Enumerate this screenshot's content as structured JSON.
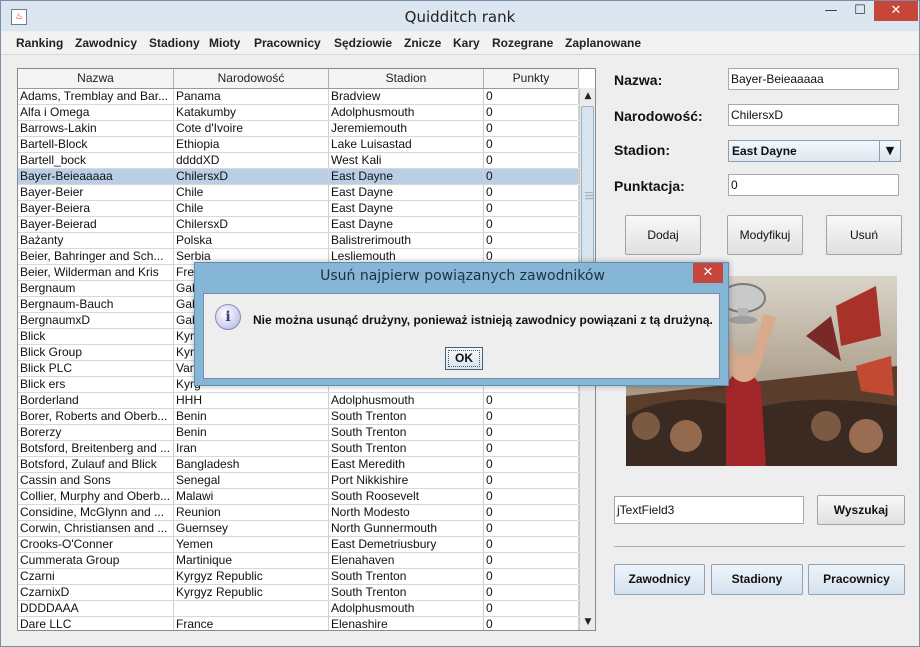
{
  "window": {
    "title": "Quidditch rank",
    "min": "—",
    "max": "☐",
    "close": "✕",
    "app_icon": "java-icon"
  },
  "menu": [
    "Ranking",
    "Zawodnicy",
    "Stadiony",
    "Mioty",
    "Pracownicy",
    "Sędziowie",
    "Znicze",
    "Kary",
    "Rozegrane",
    "Zaplanowane"
  ],
  "table": {
    "headers": [
      "Nazwa",
      "Narodowość",
      "Stadion",
      "Punkty"
    ],
    "selected_row": 5,
    "rows": [
      [
        "Adams, Tremblay and Bar...",
        "Panama",
        "Bradview",
        "0"
      ],
      [
        "Alfa i Omega",
        "Katakumby",
        "Adolphusmouth",
        "0"
      ],
      [
        "Barrows-Lakin",
        "Cote d'Ivoire",
        "Jeremiemouth",
        "0"
      ],
      [
        "Bartell-Block",
        "Ethiopia",
        "Lake Luisastad",
        "0"
      ],
      [
        "Bartell_bock",
        "ddddXD",
        "West Kali",
        "0"
      ],
      [
        "Bayer-Beieaaaaa",
        "ChilersxD",
        "East Dayne",
        "0"
      ],
      [
        "Bayer-Beier",
        "Chile",
        "East Dayne",
        "0"
      ],
      [
        "Bayer-Beiera",
        "Chile",
        "East Dayne",
        "0"
      ],
      [
        "Bayer-Beierad",
        "ChilersxD",
        "East Dayne",
        "0"
      ],
      [
        "Bażanty",
        "Polska",
        "Balistrerimouth",
        "0"
      ],
      [
        "Beier, Bahringer and Sch...",
        "Serbia",
        "Lesliemouth",
        "0"
      ],
      [
        "Beier, Wilderman and Kris",
        "Fren",
        "",
        ""
      ],
      [
        "Bergnaum",
        "Gab",
        "",
        ""
      ],
      [
        "Bergnaum-Bauch",
        "Gab",
        "",
        ""
      ],
      [
        "BergnaumxD",
        "Gab",
        "",
        ""
      ],
      [
        "Blick",
        "Kyrg",
        "",
        ""
      ],
      [
        "Blick Group",
        "Kyrg",
        "",
        ""
      ],
      [
        "Blick PLC",
        "Van",
        "",
        ""
      ],
      [
        "Blick ers",
        "Kyrg",
        "",
        ""
      ],
      [
        "Borderland",
        "HHH",
        "Adolphusmouth",
        "0"
      ],
      [
        "Borer, Roberts and Oberb...",
        "Benin",
        "South Trenton",
        "0"
      ],
      [
        "Borerzy",
        "Benin",
        "South Trenton",
        "0"
      ],
      [
        "Botsford, Breitenberg and ...",
        "Iran",
        "South Trenton",
        "0"
      ],
      [
        "Botsford, Zulauf and Blick",
        "Bangladesh",
        "East Meredith",
        "0"
      ],
      [
        "Cassin and Sons",
        "Senegal",
        "Port Nikkishire",
        "0"
      ],
      [
        "Collier, Murphy and Oberb...",
        "Malawi",
        "South Roosevelt",
        "0"
      ],
      [
        "Considine, McGlynn and ...",
        "Reunion",
        "North Modesto",
        "0"
      ],
      [
        "Corwin, Christiansen and ...",
        "Guernsey",
        "North Gunnermouth",
        "0"
      ],
      [
        "Crooks-O'Conner",
        "Yemen",
        "East Demetriusbury",
        "0"
      ],
      [
        "Cummerata Group",
        "Martinique",
        "Elenahaven",
        "0"
      ],
      [
        "Czarni",
        "Kyrgyz Republic",
        "South Trenton",
        "0"
      ],
      [
        "CzarnixD",
        "Kyrgyz Republic",
        "South Trenton",
        "0"
      ],
      [
        "DDDDAAA",
        "",
        "Adolphusmouth",
        "0"
      ],
      [
        "Dare LLC",
        "France",
        "Elenashire",
        "0"
      ]
    ]
  },
  "form": {
    "nazwa_label": "Nazwa:",
    "nazwa_value": "Bayer-Beieaaaaa",
    "narodowosc_label": "Narodowość:",
    "narodowosc_value": "ChilersxD",
    "stadion_label": "Stadion:",
    "stadion_value": "East Dayne",
    "punktacja_label": "Punktacja:",
    "punktacja_value": "0",
    "dodaj": "Dodaj",
    "modyfikuj": "Modyfikuj",
    "usun": "Usuń"
  },
  "search": {
    "value": "jTextField3",
    "button": "Wyszukaj"
  },
  "nav": {
    "zawodnicy": "Zawodnicy",
    "stadiony": "Stadiony",
    "pracownicy": "Pracownicy"
  },
  "dialog": {
    "title": "Usuń najpierw powiązanych zawodników",
    "message": "Nie można usunąć drużyny, ponieważ istnieją zawodnicy powiązani z tą drużyną.",
    "ok": "OK",
    "icon": "info-icon"
  }
}
